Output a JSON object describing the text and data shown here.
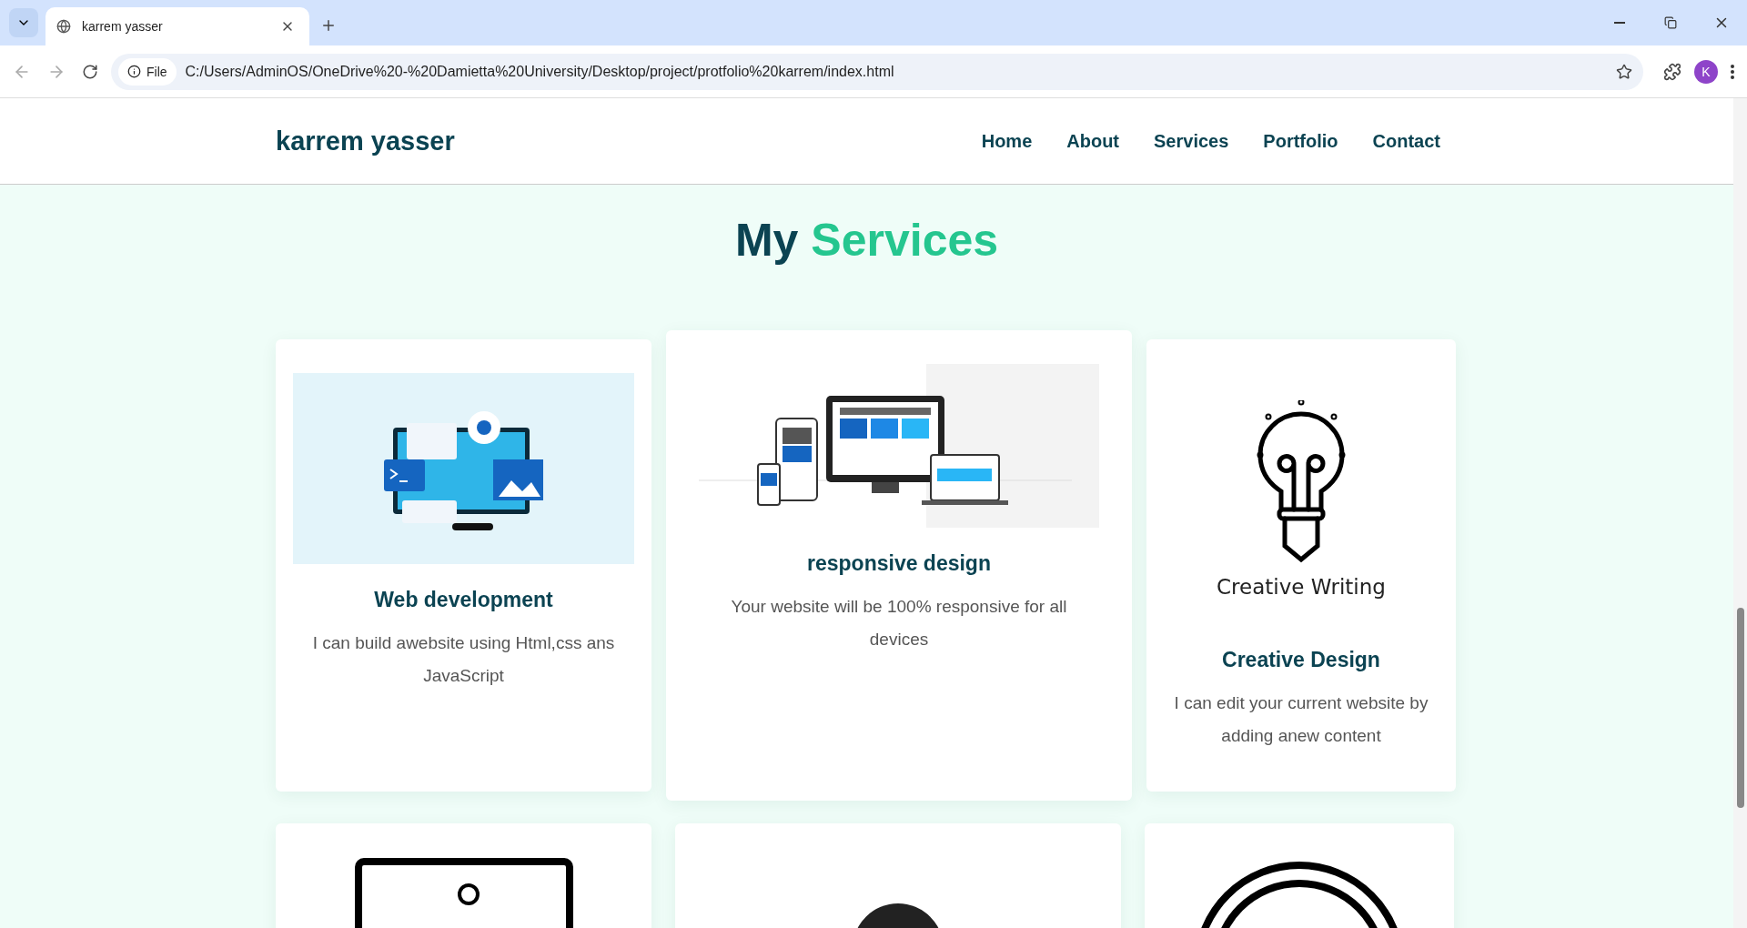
{
  "browser": {
    "tab_title": "karrem yasser",
    "site_label": "File",
    "url": "C:/Users/AdminOS/OneDrive%20-%20Damietta%20University/Desktop/project/protfolio%20karrem/index.html",
    "profile_initial": "K"
  },
  "header": {
    "logo": "karrem yasser",
    "nav": [
      {
        "label": "Home"
      },
      {
        "label": "About"
      },
      {
        "label": "Services"
      },
      {
        "label": "Portfolio"
      },
      {
        "label": "Contact"
      }
    ]
  },
  "section": {
    "title_plain": "My",
    "title_accent": "Services"
  },
  "services": [
    {
      "kind": "webdev",
      "title": "Web development",
      "text": "I can build awebsite using Html,css ans JavaScript"
    },
    {
      "kind": "responsive",
      "title": "responsive design",
      "text": "Your website will be 100% responsive for all devices"
    },
    {
      "kind": "bulb",
      "image_caption": "Creative Writing",
      "title": "Creative Design",
      "text": "I can edit your current website by adding anew content"
    }
  ],
  "more_services": [
    {
      "kind": "monitor"
    },
    {
      "kind": "disc"
    },
    {
      "kind": "rings"
    }
  ]
}
